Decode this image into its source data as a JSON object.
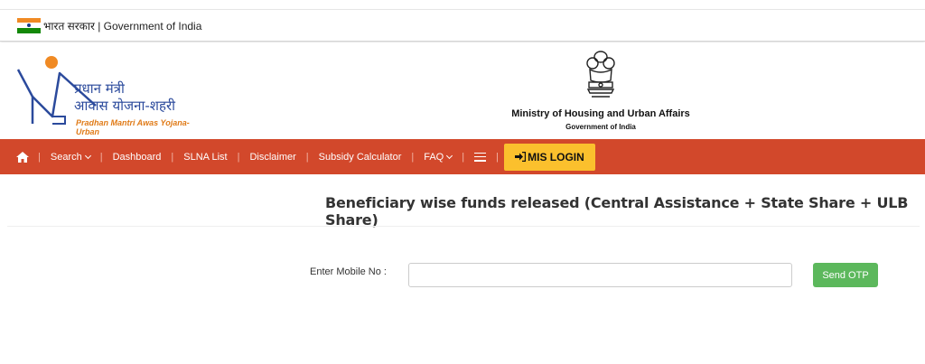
{
  "topbar": {
    "gov_text": "भारत सरकार | Government of India",
    "flag_colors": [
      "#f08a24",
      "#ffffff",
      "#138808"
    ]
  },
  "header": {
    "logo": {
      "hindi_line1": "प्रधान मंत्री",
      "hindi_line2": "आवास योजना-शहरी",
      "english": "Pradhan Mantri Awas Yojana-Urban"
    },
    "ministry": {
      "name": "Ministry of Housing and Urban Affairs",
      "sub": "Government of India",
      "icon": "national-emblem-icon"
    }
  },
  "nav": {
    "bg_color": "#d2482b",
    "home_icon": "home-icon",
    "items": [
      {
        "label": "Search",
        "has_dropdown": true
      },
      {
        "label": "Dashboard",
        "has_dropdown": false
      },
      {
        "label": "SLNA List",
        "has_dropdown": false
      },
      {
        "label": "Disclaimer",
        "has_dropdown": false
      },
      {
        "label": "Subsidy Calculator",
        "has_dropdown": false
      },
      {
        "label": "FAQ",
        "has_dropdown": true
      }
    ],
    "menu_icon": "hamburger-icon",
    "mis_login": {
      "label": "MIS LOGIN",
      "icon": "sign-in-icon",
      "color": "#fbc02d"
    }
  },
  "main": {
    "title": "Beneficiary wise funds released (Central Assistance + State Share + ULB Share)",
    "mobile_label": "Enter Mobile No :",
    "mobile_value": "",
    "mobile_placeholder": "",
    "send_otp": "Send OTP",
    "send_otp_color": "#5cb85c"
  }
}
